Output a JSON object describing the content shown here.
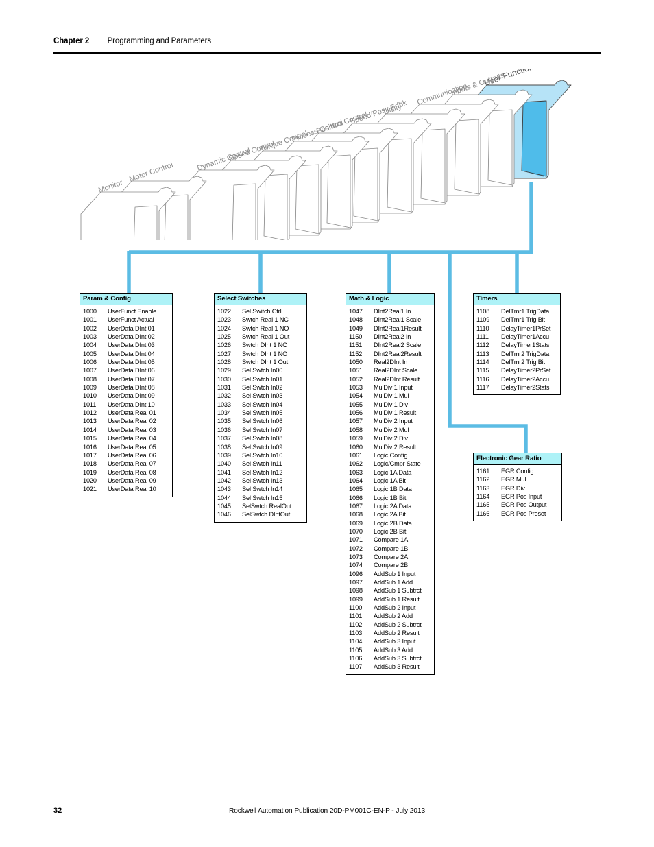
{
  "header": {
    "chapter": "Chapter 2",
    "title": "Programming and Parameters"
  },
  "footer": {
    "page_number": "32",
    "publication": "Rockwell Automation Publication 20D-PM001C-EN-P - July 2013"
  },
  "colors": {
    "connector_line": "#5BBCE4",
    "table_header_bg": "#AEF2F7",
    "highlight_folder_fill": "#A9DDF4",
    "highlight_folder_side": "#4FB9E8",
    "folder_outline": "#8A8A8A"
  },
  "folder_diagram": {
    "name": "file-folder-stack",
    "highlighted": "User Functions",
    "folders": [
      {
        "label": "Monitor",
        "highlighted": false
      },
      {
        "label": "Motor Control",
        "highlighted": false
      },
      {
        "label": "Dynamic Control",
        "highlighted": false
      },
      {
        "label": "Speed Control",
        "highlighted": false
      },
      {
        "label": "Torque Control",
        "highlighted": false
      },
      {
        "label": "Process Control",
        "highlighted": false
      },
      {
        "label": "Position Control",
        "highlighted": false
      },
      {
        "label": "Speed/Posit Fdbk",
        "highlighted": false
      },
      {
        "label": "Utility",
        "highlighted": false
      },
      {
        "label": "Communication",
        "highlighted": false
      },
      {
        "label": "Inputs & Outputs",
        "highlighted": false
      },
      {
        "label": "User Functions",
        "highlighted": true
      }
    ]
  },
  "tables": [
    {
      "id": "param-config",
      "title": "Param & Config",
      "rows": [
        {
          "code": "1000",
          "name": "UserFunct Enable"
        },
        {
          "code": "1001",
          "name": "UserFunct Actual"
        },
        {
          "code": "1002",
          "name": "UserData DInt 01"
        },
        {
          "code": "1003",
          "name": "UserData DInt 02"
        },
        {
          "code": "1004",
          "name": "UserData DInt 03"
        },
        {
          "code": "1005",
          "name": "UserData DInt 04"
        },
        {
          "code": "1006",
          "name": "UserData DInt 05"
        },
        {
          "code": "1007",
          "name": "UserData DInt 06"
        },
        {
          "code": "1008",
          "name": "UserData DInt 07"
        },
        {
          "code": "1009",
          "name": "UserData DInt 08"
        },
        {
          "code": "1010",
          "name": "UserData DInt 09"
        },
        {
          "code": "1011",
          "name": "UserData DInt 10"
        },
        {
          "code": "1012",
          "name": "UserData Real 01"
        },
        {
          "code": "1013",
          "name": "UserData Real 02"
        },
        {
          "code": "1014",
          "name": "UserData Real 03"
        },
        {
          "code": "1015",
          "name": "UserData Real 04"
        },
        {
          "code": "1016",
          "name": "UserData Real 05"
        },
        {
          "code": "1017",
          "name": "UserData Real 06"
        },
        {
          "code": "1018",
          "name": "UserData Real 07"
        },
        {
          "code": "1019",
          "name": "UserData Real 08"
        },
        {
          "code": "1020",
          "name": "UserData Real 09"
        },
        {
          "code": "1021",
          "name": "UserData Real 10"
        }
      ]
    },
    {
      "id": "select-switches",
      "title": "Select Switches",
      "rows": [
        {
          "code": "1022",
          "name": "Sel Switch Ctrl"
        },
        {
          "code": "1023",
          "name": "Swtch Real 1 NC"
        },
        {
          "code": "1024",
          "name": "Swtch Real 1 NO"
        },
        {
          "code": "1025",
          "name": "Swtch Real 1 Out"
        },
        {
          "code": "1026",
          "name": "Swtch DInt 1 NC"
        },
        {
          "code": "1027",
          "name": "Swtch DInt 1 NO"
        },
        {
          "code": "1028",
          "name": "Swtch DInt 1 Out"
        },
        {
          "code": "1029",
          "name": "Sel Swtch In00"
        },
        {
          "code": "1030",
          "name": "Sel Swtch In01"
        },
        {
          "code": "1031",
          "name": "Sel Swtch In02"
        },
        {
          "code": "1032",
          "name": "Sel Swtch In03"
        },
        {
          "code": "1033",
          "name": "Sel Swtch In04"
        },
        {
          "code": "1034",
          "name": "Sel Swtch In05"
        },
        {
          "code": "1035",
          "name": "Sel Swtch In06"
        },
        {
          "code": "1036",
          "name": "Sel Swtch In07"
        },
        {
          "code": "1037",
          "name": "Sel Swtch In08"
        },
        {
          "code": "1038",
          "name": "Sel Swtch In09"
        },
        {
          "code": "1039",
          "name": "Sel Swtch In10"
        },
        {
          "code": "1040",
          "name": "Sel Swtch In11"
        },
        {
          "code": "1041",
          "name": "Sel Swtch In12"
        },
        {
          "code": "1042",
          "name": "Sel Swtch In13"
        },
        {
          "code": "1043",
          "name": "Sel Swtch In14"
        },
        {
          "code": "1044",
          "name": "Sel Swtch In15"
        },
        {
          "code": "1045",
          "name": "SelSwtch RealOut"
        },
        {
          "code": "1046",
          "name": "SelSwtch DIntOut"
        }
      ]
    },
    {
      "id": "math-logic",
      "title": "Math & Logic",
      "rows": [
        {
          "code": "1047",
          "name": "DInt2Real1 In"
        },
        {
          "code": "1048",
          "name": "DInt2Real1 Scale"
        },
        {
          "code": "1049",
          "name": "DInt2Real1Result"
        },
        {
          "code": "1150",
          "name": "DInt2Real2 In"
        },
        {
          "code": "1151",
          "name": "DInt2Real2 Scale"
        },
        {
          "code": "1152",
          "name": "DInt2Real2Result"
        },
        {
          "code": "1050",
          "name": "Real2DInt In"
        },
        {
          "code": "1051",
          "name": "Real2DInt Scale"
        },
        {
          "code": "1052",
          "name": "Real2DInt Result"
        },
        {
          "code": "1053",
          "name": "MulDiv 1 Input"
        },
        {
          "code": "1054",
          "name": "MulDiv 1 Mul"
        },
        {
          "code": "1055",
          "name": "MulDiv 1 Div"
        },
        {
          "code": "1056",
          "name": "MulDiv 1 Result"
        },
        {
          "code": "1057",
          "name": "MulDiv 2 Input"
        },
        {
          "code": "1058",
          "name": "MulDiv 2 Mul"
        },
        {
          "code": "1059",
          "name": "MulDiv 2 Div"
        },
        {
          "code": "1060",
          "name": "MulDiv 2 Result"
        },
        {
          "code": "1061",
          "name": "Logic Config"
        },
        {
          "code": "1062",
          "name": "Logic/Cmpr State"
        },
        {
          "code": "1063",
          "name": "Logic 1A Data"
        },
        {
          "code": "1064",
          "name": "Logic 1A Bit"
        },
        {
          "code": "1065",
          "name": "Logic 1B Data"
        },
        {
          "code": "1066",
          "name": "Logic 1B Bit"
        },
        {
          "code": "1067",
          "name": "Logic 2A Data"
        },
        {
          "code": "1068",
          "name": "Logic 2A Bit"
        },
        {
          "code": "1069",
          "name": "Logic 2B Data"
        },
        {
          "code": "1070",
          "name": "Logic 2B Bit"
        },
        {
          "code": "1071",
          "name": "Compare 1A"
        },
        {
          "code": "1072",
          "name": "Compare 1B"
        },
        {
          "code": "1073",
          "name": "Compare 2A"
        },
        {
          "code": "1074",
          "name": "Compare 2B"
        },
        {
          "code": "1096",
          "name": "AddSub 1 Input"
        },
        {
          "code": "1097",
          "name": "AddSub 1 Add"
        },
        {
          "code": "1098",
          "name": "AddSub 1 Subtrct"
        },
        {
          "code": "1099",
          "name": "AddSub 1 Result"
        },
        {
          "code": "1100",
          "name": "AddSub 2 Input"
        },
        {
          "code": "1101",
          "name": "AddSub 2 Add"
        },
        {
          "code": "1102",
          "name": "AddSub 2 Subtrct"
        },
        {
          "code": "1103",
          "name": "AddSub 2 Result"
        },
        {
          "code": "1104",
          "name": "AddSub 3 Input"
        },
        {
          "code": "1105",
          "name": "AddSub 3 Add"
        },
        {
          "code": "1106",
          "name": "AddSub 3 Subtrct"
        },
        {
          "code": "1107",
          "name": "AddSub 3 Result"
        }
      ]
    },
    {
      "id": "timers",
      "title": "Timers",
      "rows": [
        {
          "code": "1108",
          "name": "DelTmr1 TrigData"
        },
        {
          "code": "1109",
          "name": "DelTmr1 Trig Bit"
        },
        {
          "code": "1110",
          "name": "DelayTimer1PrSet"
        },
        {
          "code": "1111",
          "name": "DelayTimer1Accu"
        },
        {
          "code": "1112",
          "name": "DelayTimer1Stats"
        },
        {
          "code": "1113",
          "name": "DelTmr2 TrigData"
        },
        {
          "code": "1114",
          "name": "DelTmr2 Trig Bit"
        },
        {
          "code": "1115",
          "name": "DelayTimer2PrSet"
        },
        {
          "code": "1116",
          "name": "DelayTimer2Accu"
        },
        {
          "code": "1117",
          "name": "DelayTimer2Stats"
        }
      ]
    },
    {
      "id": "egr",
      "title": "Electronic Gear Ratio",
      "rows": [
        {
          "code": "1161",
          "name": "EGR Config"
        },
        {
          "code": "1162",
          "name": "EGR Mul"
        },
        {
          "code": "1163",
          "name": "EGR Div"
        },
        {
          "code": "1164",
          "name": "EGR Pos Input"
        },
        {
          "code": "1165",
          "name": "EGR Pos Output"
        },
        {
          "code": "1166",
          "name": "EGR Pos Preset"
        }
      ]
    }
  ]
}
